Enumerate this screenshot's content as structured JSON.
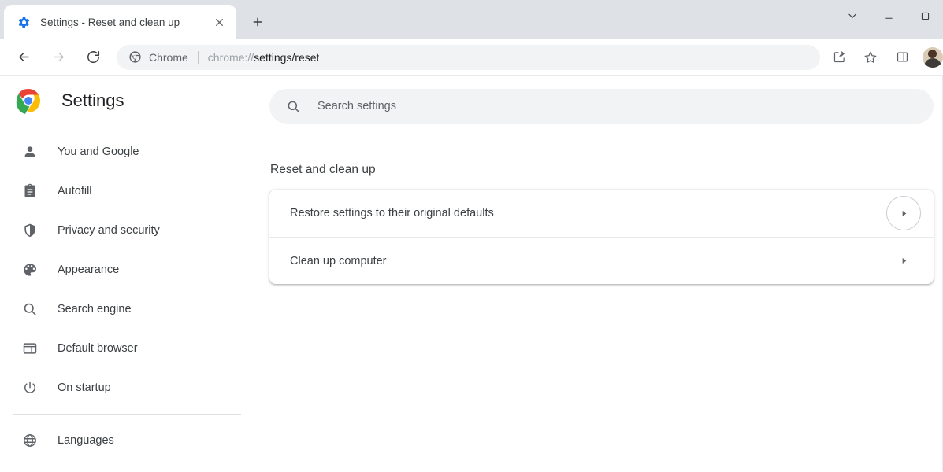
{
  "window": {
    "controls": [
      {
        "name": "tab-search-button",
        "icon": "chevron-down-icon",
        "label": "Search tabs"
      },
      {
        "name": "minimize-button",
        "icon": "minimize-icon",
        "label": "Minimize"
      },
      {
        "name": "maximize-button",
        "icon": "maximize-icon",
        "label": "Maximize"
      }
    ]
  },
  "tabstrip": {
    "tab": {
      "title": "Settings - Reset and clean up",
      "favicon": "gear-icon",
      "close_label": "Close"
    },
    "new_tab_label": "New tab"
  },
  "toolbar": {
    "back_label": "Back",
    "forward_label": "Forward",
    "reload_label": "Reload",
    "omnibox": {
      "icon": "chrome-icon",
      "scheme_chip": "Chrome",
      "url_prefix": "chrome://",
      "url_strong": "settings/reset",
      "full_url": "chrome://settings/reset"
    },
    "actions": [
      {
        "name": "share-button",
        "icon": "share-icon",
        "label": "Share this page"
      },
      {
        "name": "bookmark-button",
        "icon": "star-icon",
        "label": "Bookmark this tab"
      },
      {
        "name": "side-panel-button",
        "icon": "side-panel-icon",
        "label": "Side panel"
      }
    ],
    "avatar_label": "Profile"
  },
  "sidebar": {
    "logo": "chrome-logo-icon",
    "title": "Settings",
    "items": [
      {
        "icon": "person-icon",
        "label": "You and Google"
      },
      {
        "icon": "clipboard-icon",
        "label": "Autofill"
      },
      {
        "icon": "shield-icon",
        "label": "Privacy and security"
      },
      {
        "icon": "palette-icon",
        "label": "Appearance"
      },
      {
        "icon": "magnifier-icon",
        "label": "Search engine"
      },
      {
        "icon": "browser-window-icon",
        "label": "Default browser"
      },
      {
        "icon": "power-icon",
        "label": "On startup"
      }
    ],
    "items_after_divider": [
      {
        "icon": "globe-icon",
        "label": "Languages"
      }
    ]
  },
  "search": {
    "icon": "search-icon",
    "placeholder": "Search settings",
    "value": ""
  },
  "main": {
    "section_title": "Reset and clean up",
    "rows": [
      {
        "label": "Restore settings to their original defaults",
        "arrow": "chevron-right-icon",
        "focused": true
      },
      {
        "label": "Clean up computer",
        "arrow": "chevron-right-icon",
        "focused": false
      }
    ]
  },
  "colors": {
    "tabstrip_bg": "#dee1e6",
    "omnibox_bg": "#f1f3f4",
    "text_primary": "#202124",
    "text_secondary": "#5f6368",
    "divider": "#e8eaed",
    "focus_ring": "#c6cdd4"
  }
}
